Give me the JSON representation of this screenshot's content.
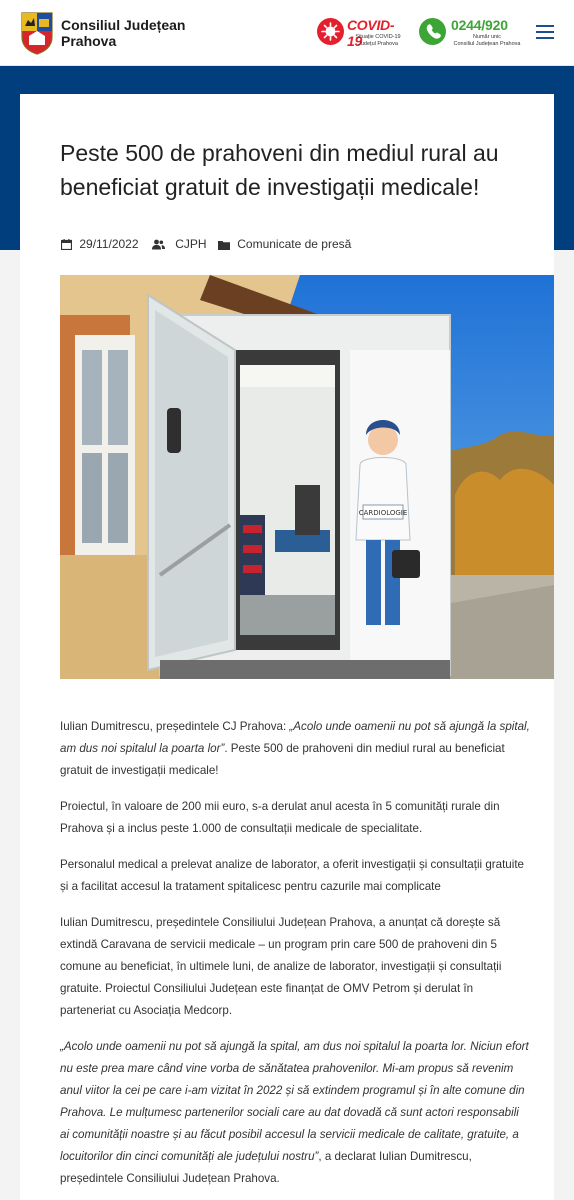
{
  "header": {
    "site_name_line1": "Consiliul Județean",
    "site_name_line2": "Prahova",
    "covid": {
      "title": "COVID-19",
      "subtitle_line1": "Situație COVID-19",
      "subtitle_line2": "Județul Prahova",
      "color": "#e5202c",
      "icon": "virus-icon"
    },
    "phone": {
      "number": "0244/920",
      "subtitle_line1": "Număr unic",
      "subtitle_line2": "Consiliul Județean Prahova",
      "color": "#3ca535",
      "icon": "phone-icon"
    },
    "menu_icon": "hamburger-menu-icon"
  },
  "colors": {
    "band": "#003e7e",
    "accent": "#1f4e8c"
  },
  "article": {
    "title": "Peste 500 de prahoveni din mediul rural au beneficiat gratuit de investigații medicale!",
    "date": "29/11/2022",
    "author": "CJPH",
    "category": "Comunicate de presă",
    "image_label": "CARDIOLOGIE",
    "p1_plain_a": "Iulian Dumitrescu, președintele CJ Prahova: ",
    "p1_italic": "„Acolo unde oamenii nu pot să ajungă la spital, am dus noi spitalul la poarta lor”",
    "p1_plain_b": ". Peste 500 de prahoveni din mediul rural au beneficiat gratuit de investigații medicale!",
    "p2": "Proiectul, în valoare de 200 mii euro, s-a derulat anul acesta în 5 comunități rurale din Prahova și a inclus peste 1.000 de consultații medicale de specialitate.",
    "p3": "Personalul medical a prelevat analize de laborator, a oferit investigații și consultații gratuite și a facilitat accesul la tratament spitalicesc pentru cazurile mai complicate",
    "p4": "Iulian Dumitrescu, președintele Consiliului Județean Prahova, a anunțat că dorește să extindă Caravana de servicii medicale – un program prin care 500 de prahoveni din 5 comune au beneficiat, în ultimele luni, de analize de laborator, investigații și consultații gratuite. Proiectul Consiliului Județean este finanțat de OMV Petrom și derulat în parteneriat cu Asociația Medcorp.",
    "p5_italic": "„Acolo unde oamenii nu pot să ajungă la spital, am dus noi spitalul la poarta lor. Niciun efort nu este prea mare când vine vorba de sănătatea prahovenilor. Mi-am propus să revenim anul viitor la cei pe care i-am vizitat în 2022 și să extindem programul și în alte comune din Prahova. Le mulțumesc partenerilor sociali care au dat dovadă că sunt actori responsabili ai comunității noastre și au făcut posibil accesul la servicii medicale de calitate, gratuite, a locuitorilor din cinci comunități ale județului nostru”",
    "p5_plain": ", a declarat Iulian Dumitrescu, președintele Consiliului Județean Prahova."
  }
}
